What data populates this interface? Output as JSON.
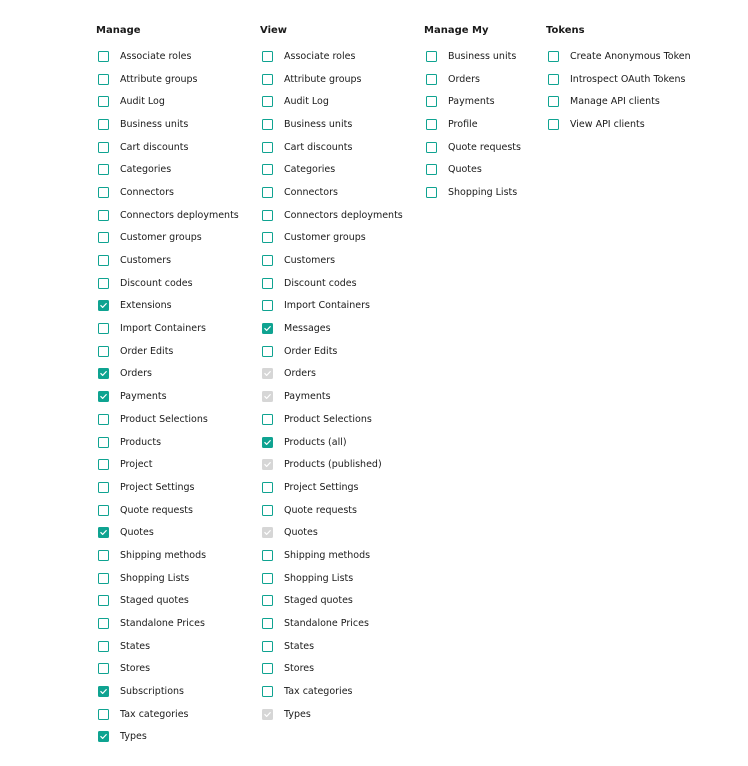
{
  "colors": {
    "accent": "#0fa391",
    "disabled": "#d6d6d6"
  },
  "columns": [
    {
      "title": "Manage",
      "items": [
        {
          "label": "Associate roles",
          "state": "unchecked"
        },
        {
          "label": "Attribute groups",
          "state": "unchecked"
        },
        {
          "label": "Audit Log",
          "state": "unchecked"
        },
        {
          "label": "Business units",
          "state": "unchecked"
        },
        {
          "label": "Cart discounts",
          "state": "unchecked"
        },
        {
          "label": "Categories",
          "state": "unchecked"
        },
        {
          "label": "Connectors",
          "state": "unchecked"
        },
        {
          "label": "Connectors deployments",
          "state": "unchecked"
        },
        {
          "label": "Customer groups",
          "state": "unchecked"
        },
        {
          "label": "Customers",
          "state": "unchecked"
        },
        {
          "label": "Discount codes",
          "state": "unchecked"
        },
        {
          "label": "Extensions",
          "state": "checked"
        },
        {
          "label": "Import Containers",
          "state": "unchecked"
        },
        {
          "label": "Order Edits",
          "state": "unchecked"
        },
        {
          "label": "Orders",
          "state": "checked"
        },
        {
          "label": "Payments",
          "state": "checked"
        },
        {
          "label": "Product Selections",
          "state": "unchecked"
        },
        {
          "label": "Products",
          "state": "unchecked"
        },
        {
          "label": "Project",
          "state": "unchecked"
        },
        {
          "label": "Project Settings",
          "state": "unchecked"
        },
        {
          "label": "Quote requests",
          "state": "unchecked"
        },
        {
          "label": "Quotes",
          "state": "checked"
        },
        {
          "label": "Shipping methods",
          "state": "unchecked"
        },
        {
          "label": "Shopping Lists",
          "state": "unchecked"
        },
        {
          "label": "Staged quotes",
          "state": "unchecked"
        },
        {
          "label": "Standalone Prices",
          "state": "unchecked"
        },
        {
          "label": "States",
          "state": "unchecked"
        },
        {
          "label": "Stores",
          "state": "unchecked"
        },
        {
          "label": "Subscriptions",
          "state": "checked"
        },
        {
          "label": "Tax categories",
          "state": "unchecked"
        },
        {
          "label": "Types",
          "state": "checked"
        }
      ]
    },
    {
      "title": "View",
      "items": [
        {
          "label": "Associate roles",
          "state": "unchecked"
        },
        {
          "label": "Attribute groups",
          "state": "unchecked"
        },
        {
          "label": "Audit Log",
          "state": "unchecked"
        },
        {
          "label": "Business units",
          "state": "unchecked"
        },
        {
          "label": "Cart discounts",
          "state": "unchecked"
        },
        {
          "label": "Categories",
          "state": "unchecked"
        },
        {
          "label": "Connectors",
          "state": "unchecked"
        },
        {
          "label": "Connectors deployments",
          "state": "unchecked"
        },
        {
          "label": "Customer groups",
          "state": "unchecked"
        },
        {
          "label": "Customers",
          "state": "unchecked"
        },
        {
          "label": "Discount codes",
          "state": "unchecked"
        },
        {
          "label": "Import Containers",
          "state": "unchecked"
        },
        {
          "label": "Messages",
          "state": "checked"
        },
        {
          "label": "Order Edits",
          "state": "unchecked"
        },
        {
          "label": "Orders",
          "state": "disabled-checked"
        },
        {
          "label": "Payments",
          "state": "disabled-checked"
        },
        {
          "label": "Product Selections",
          "state": "unchecked"
        },
        {
          "label": "Products (all)",
          "state": "checked"
        },
        {
          "label": "Products (published)",
          "state": "disabled-checked"
        },
        {
          "label": "Project Settings",
          "state": "unchecked"
        },
        {
          "label": "Quote requests",
          "state": "unchecked"
        },
        {
          "label": "Quotes",
          "state": "disabled-checked"
        },
        {
          "label": "Shipping methods",
          "state": "unchecked"
        },
        {
          "label": "Shopping Lists",
          "state": "unchecked"
        },
        {
          "label": "Staged quotes",
          "state": "unchecked"
        },
        {
          "label": "Standalone Prices",
          "state": "unchecked"
        },
        {
          "label": "States",
          "state": "unchecked"
        },
        {
          "label": "Stores",
          "state": "unchecked"
        },
        {
          "label": "Tax categories",
          "state": "unchecked"
        },
        {
          "label": "Types",
          "state": "disabled-checked"
        }
      ]
    },
    {
      "title": "Manage My",
      "items": [
        {
          "label": "Business units",
          "state": "unchecked"
        },
        {
          "label": "Orders",
          "state": "unchecked"
        },
        {
          "label": "Payments",
          "state": "unchecked"
        },
        {
          "label": "Profile",
          "state": "unchecked"
        },
        {
          "label": "Quote requests",
          "state": "unchecked"
        },
        {
          "label": "Quotes",
          "state": "unchecked"
        },
        {
          "label": "Shopping Lists",
          "state": "unchecked"
        }
      ]
    },
    {
      "title": "Tokens",
      "items": [
        {
          "label": "Create Anonymous Token",
          "state": "unchecked"
        },
        {
          "label": "Introspect OAuth Tokens",
          "state": "unchecked"
        },
        {
          "label": "Manage API clients",
          "state": "unchecked"
        },
        {
          "label": "View API clients",
          "state": "unchecked"
        }
      ]
    }
  ]
}
